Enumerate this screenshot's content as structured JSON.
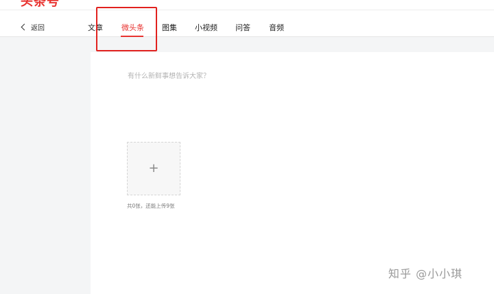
{
  "header": {
    "logo_text": "头条号"
  },
  "nav": {
    "back_label": "返回",
    "tabs": [
      {
        "label": "文章",
        "active": false
      },
      {
        "label": "微头条",
        "active": true
      },
      {
        "label": "图集",
        "active": false
      },
      {
        "label": "小视频",
        "active": false
      },
      {
        "label": "问答",
        "active": false
      },
      {
        "label": "音频",
        "active": false
      }
    ]
  },
  "editor": {
    "placeholder": "有什么新鲜事想告诉大家？",
    "value": "",
    "upload_icon": "plus-icon",
    "upload_hint": "共0张，还能上传9张"
  },
  "watermark": {
    "text": "知乎 @小小琪"
  },
  "colors": {
    "accent": "#e8322f",
    "highlight_box": "#e1211e",
    "page_bg": "#f4f5f6",
    "panel_bg": "#ffffff"
  }
}
